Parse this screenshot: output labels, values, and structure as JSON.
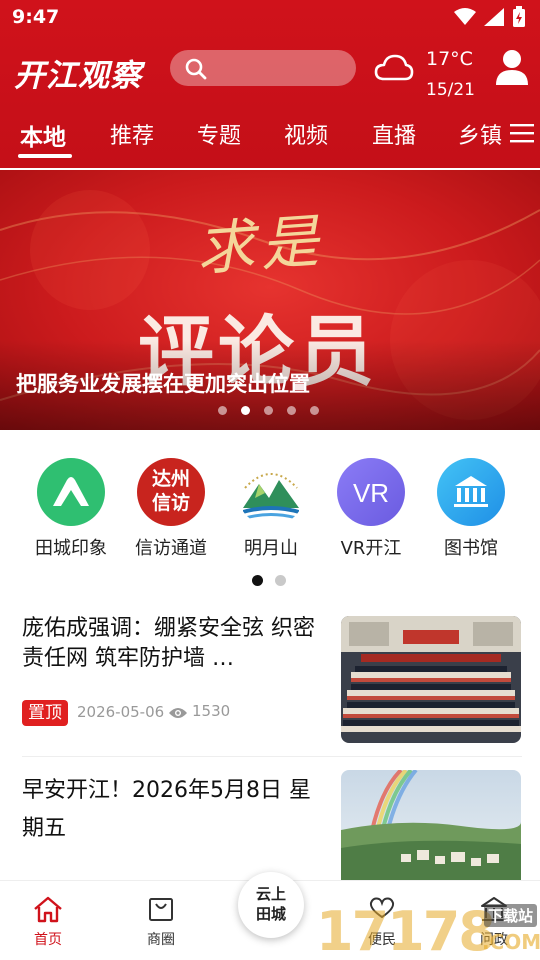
{
  "status": {
    "time": "9:47"
  },
  "header": {
    "logo": "开江观察",
    "weather": {
      "temp": "17°C",
      "range": "15/21",
      "icon": "cloud-icon"
    }
  },
  "tabs": [
    {
      "label": "本地",
      "active": true
    },
    {
      "label": "推荐"
    },
    {
      "label": "专题"
    },
    {
      "label": "视频"
    },
    {
      "label": "直播"
    },
    {
      "label": "乡镇"
    }
  ],
  "banner": {
    "calligraphy": "求是",
    "headline": "评论员",
    "caption": "把服务业发展摆在更加突出位置",
    "slide_count": 5,
    "active_slide": 1
  },
  "quick_links": [
    {
      "label": "田城印象",
      "icon": "mountain-icon",
      "color": "#2fbf71"
    },
    {
      "label": "信访通道",
      "icon": "xinfang-seal-icon",
      "color": "#c8241e",
      "seal": [
        "达州",
        "信访"
      ]
    },
    {
      "label": "明月山",
      "icon": "mingyue-mountain-icon",
      "color": "#ffffff"
    },
    {
      "label": "VR开江",
      "icon": "vr-icon",
      "color": "#7c6cf0",
      "glyph": "VR"
    },
    {
      "label": "图书馆",
      "icon": "library-icon",
      "color": "#29a8f0"
    }
  ],
  "quick_page": {
    "count": 2,
    "active": 0
  },
  "news": [
    {
      "title": "庞佑成强调：绷紧安全弦 织密责任网 筑牢防护墙 …",
      "badge": "置顶",
      "date": "2026-05-06",
      "views": "1530"
    },
    {
      "title": "早安开江！2026年5月8日 星期五"
    }
  ],
  "bottom_nav": {
    "items": [
      {
        "label": "首页",
        "icon": "home-icon",
        "active": true
      },
      {
        "label": "商圈",
        "icon": "shopping-bag-icon"
      },
      {
        "label": "便民",
        "icon": "heart-hand-icon"
      },
      {
        "label": "问政",
        "icon": "building-icon"
      }
    ],
    "center_lines": [
      "云上",
      "田城"
    ]
  },
  "watermark": {
    "text": "17178",
    "suffix": "下载站",
    "domain": ".COM"
  },
  "colors": {
    "brand": "#d0121b",
    "accent_badge": "#e02020"
  }
}
